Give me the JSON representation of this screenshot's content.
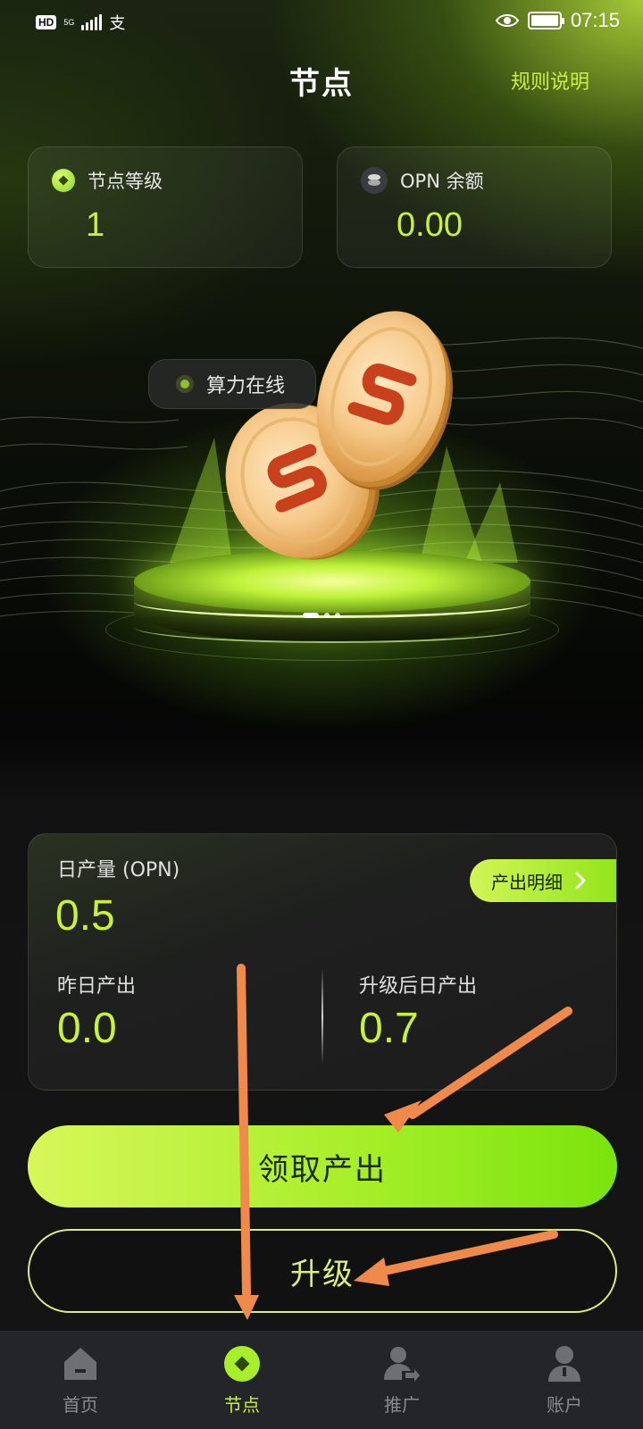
{
  "status_bar": {
    "hd": "HD",
    "network": "5G",
    "time": "07:15",
    "alipay_glyph": "支"
  },
  "header": {
    "title": "节点",
    "rules_link": "规则说明"
  },
  "cards": {
    "level": {
      "label": "节点等级",
      "value": "1"
    },
    "balance": {
      "label": "OPN 余额",
      "value": "0.00"
    }
  },
  "hero": {
    "status_label": "算力在线",
    "pager_count": 3,
    "pager_active": 0
  },
  "stats": {
    "daily_label": "日产量 (OPN)",
    "daily_value": "0.5",
    "detail_button": "产出明细",
    "yesterday_label": "昨日产出",
    "yesterday_value": "0.0",
    "after_upgrade_label": "升级后日产出",
    "after_upgrade_value": "0.7"
  },
  "actions": {
    "claim": "领取产出",
    "upgrade": "升级"
  },
  "nav": [
    {
      "label": "首页",
      "icon": "home-icon",
      "active": false
    },
    {
      "label": "节点",
      "icon": "node-icon",
      "active": true
    },
    {
      "label": "推广",
      "icon": "promote-icon",
      "active": false
    },
    {
      "label": "账户",
      "icon": "account-icon",
      "active": false
    }
  ],
  "colors": {
    "accent": "#c8f03c",
    "annotation_arrow": "#f08a4b"
  }
}
